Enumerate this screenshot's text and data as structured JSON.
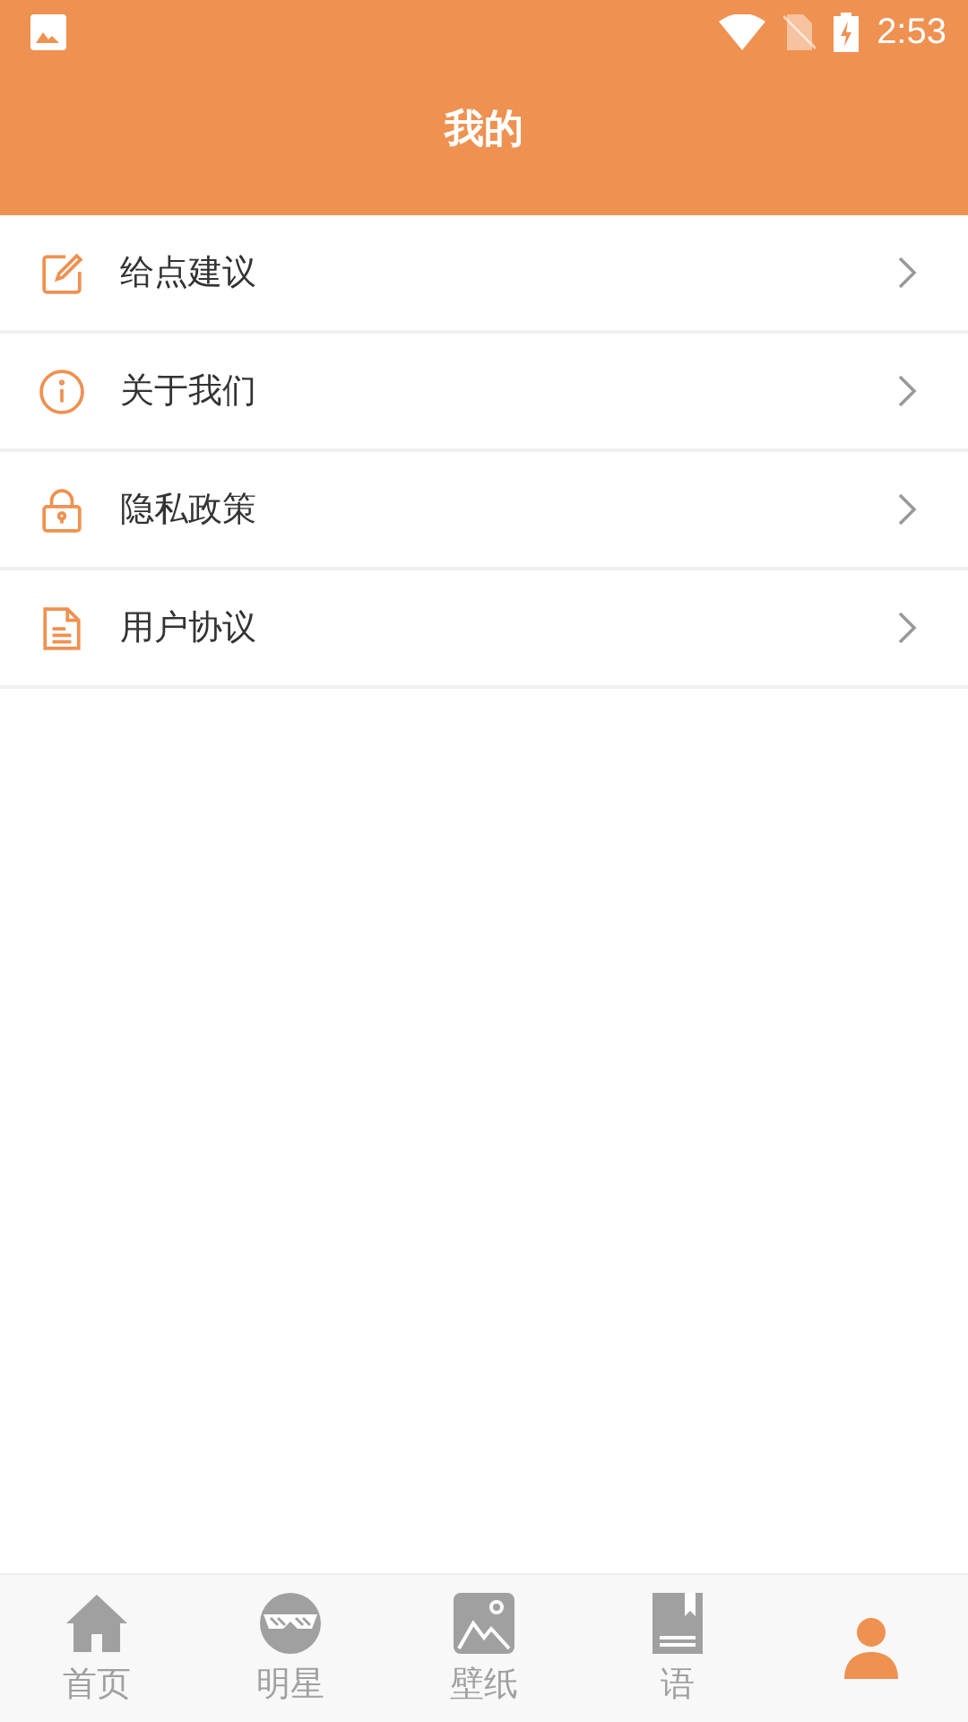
{
  "status_bar": {
    "time": "2:53"
  },
  "header": {
    "title": "我的"
  },
  "menu": [
    {
      "label": "给点建议",
      "kind": "edit"
    },
    {
      "label": "关于我们",
      "kind": "info"
    },
    {
      "label": "隐私政策",
      "kind": "lock"
    },
    {
      "label": "用户协议",
      "kind": "doc"
    }
  ],
  "tab_bar": [
    {
      "label": "首页",
      "kind": "home",
      "selected": false
    },
    {
      "label": "明星",
      "kind": "star",
      "selected": false
    },
    {
      "label": "壁纸",
      "kind": "image",
      "selected": false
    },
    {
      "label": "语",
      "kind": "book",
      "selected": false
    },
    {
      "kind": "person",
      "selected": true
    }
  ]
}
